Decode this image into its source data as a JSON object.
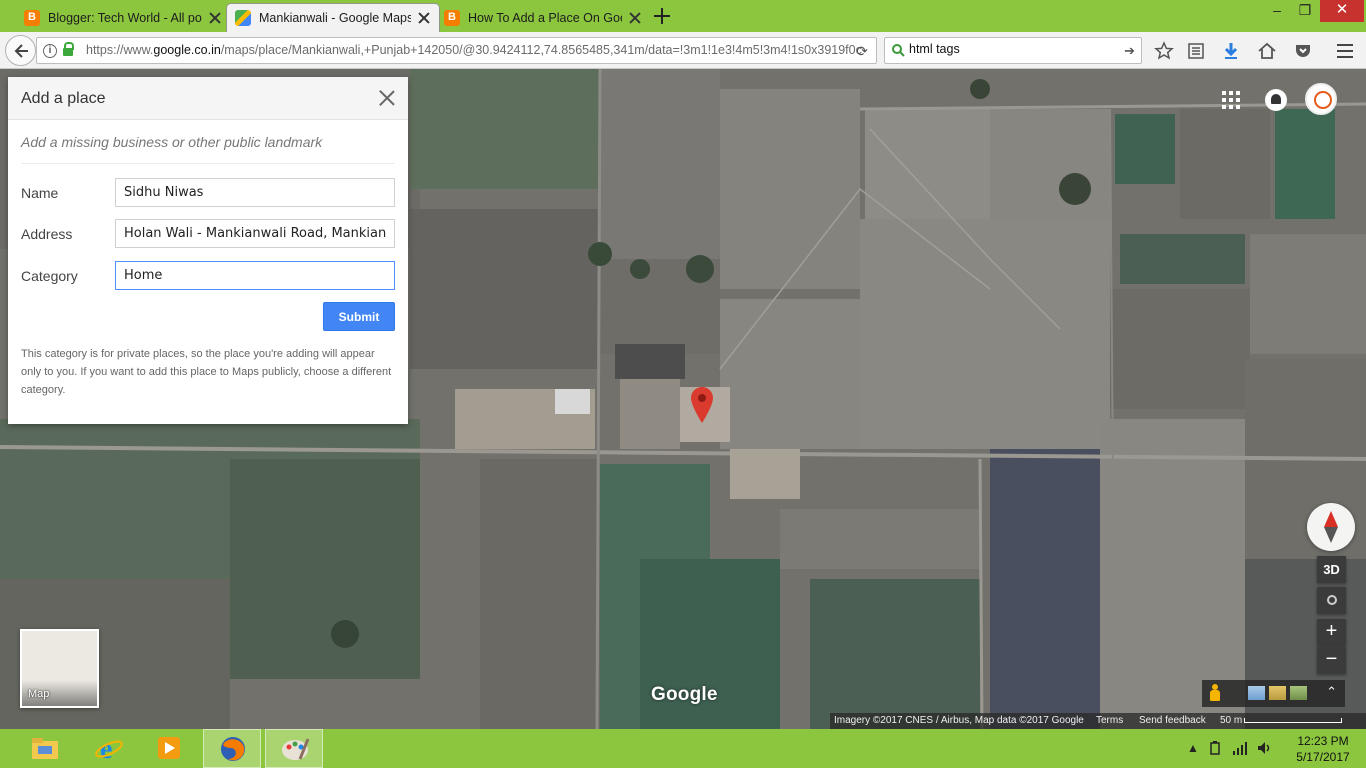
{
  "browser": {
    "tabs": [
      {
        "label": "Blogger: Tech World - All posts",
        "favicon": "blogger-icon",
        "active": false
      },
      {
        "label": "Mankianwali - Google Maps",
        "favicon": "google-maps-icon",
        "active": true
      },
      {
        "label": "How To Add a Place On Google Maps",
        "favicon": "blogger-icon",
        "active": false
      }
    ],
    "window_controls": {
      "minimize": "–",
      "maximize": "❐",
      "close": "✕"
    },
    "url": {
      "prefix": "https://www.",
      "host": "google.co.in",
      "path": "/maps/place/Mankianwali,+Punjab+142050/@30.9424112,74.8565485,341m/data=!3m1!1e3!4m5!3m4!1s0x3919f0c"
    },
    "search_value": "html tags"
  },
  "map": {
    "panel": {
      "title": "Add a place",
      "subtitle": "Add a missing business or other public landmark",
      "fields": {
        "name": {
          "label": "Name",
          "value": "Sidhu Niwas"
        },
        "address": {
          "label": "Address",
          "value": "Holan Wali - Mankianwali Road, Mankianw"
        },
        "category": {
          "label": "Category",
          "value": "Home"
        }
      },
      "submit_label": "Submit",
      "note": "This category is for private places, so the place you're adding will appear only to you. If you want to add this place to Maps publicly, choose a different category."
    },
    "maptype_label": "Map",
    "logo_text": "Google",
    "controls": {
      "three_d": "3D",
      "zoom_in": "+",
      "zoom_out": "−"
    },
    "attribution": {
      "imagery": "Imagery ©2017 CNES / Airbus, Map data ©2017 Google",
      "terms": "Terms",
      "feedback": "Send feedback",
      "scale": "50 m"
    },
    "colors": {
      "marker": "#db3b2e",
      "submit": "#4285f4",
      "accent_green": "#8cc63f"
    }
  },
  "taskbar": {
    "apps": [
      "file-explorer-icon",
      "internet-explorer-icon",
      "media-player-icon",
      "firefox-icon",
      "paint-icon"
    ],
    "clock_time": "12:23 PM",
    "clock_date": "5/17/2017"
  }
}
